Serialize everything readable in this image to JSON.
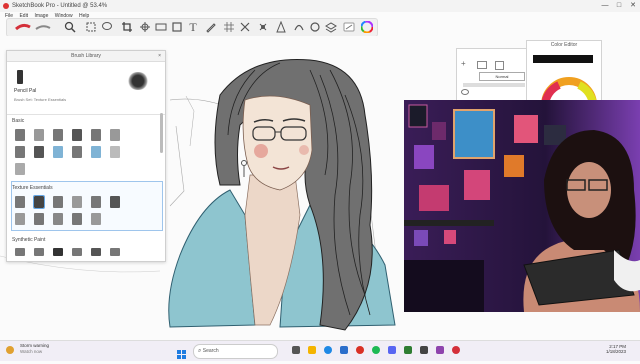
{
  "app": {
    "window_title": "SketchBook Pro - Untitled @ 53.4%",
    "menu": [
      "File",
      "Edit",
      "Image",
      "Window",
      "Help"
    ],
    "window_controls": [
      "—",
      "□",
      "✕"
    ]
  },
  "toolbar": {
    "tools": [
      "brush-red",
      "brush-gray",
      "search",
      "select",
      "lasso",
      "crop",
      "transform",
      "ruler",
      "rect",
      "ellipse",
      "line",
      "text",
      "pen",
      "grid",
      "symmetry",
      "fill",
      "perspective",
      "curve",
      "layers",
      "swatch",
      "color-wheel"
    ]
  },
  "brush_library": {
    "title": "Brush Library",
    "selected_brush_name": "Pencil Pal",
    "selected_brush_set": "Brush Set: Texture Essentials",
    "sections": [
      {
        "name": "Basic",
        "count": 13
      },
      {
        "name": "Texture Essentials",
        "count": 11
      },
      {
        "name": "Synthetic Paint",
        "count": 6
      }
    ]
  },
  "layer_panel": {
    "blend_mode": "Normal",
    "opacity": "100"
  },
  "color_editor": {
    "title": "Color Editor"
  },
  "taskbar": {
    "weather_line1": "Storm warning",
    "weather_line2": "Watch now",
    "search_placeholder": "Search",
    "time": "2:17 PM",
    "date": "1/18/2023"
  }
}
